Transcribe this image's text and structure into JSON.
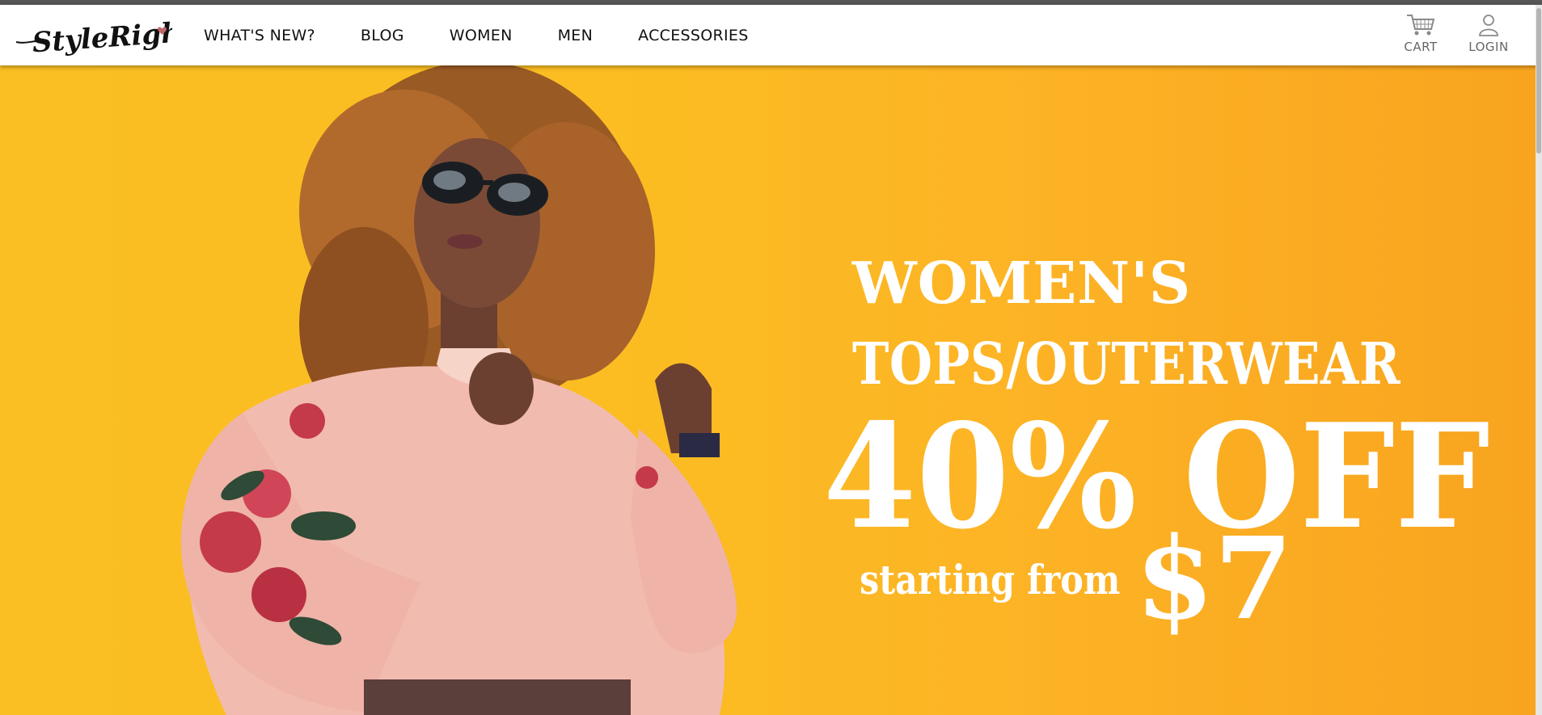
{
  "brand": {
    "name": "StyleRight",
    "accent_color": "#c0676b"
  },
  "nav": {
    "links": [
      {
        "label": "WHAT'S NEW?"
      },
      {
        "label": "BLOG"
      },
      {
        "label": "WOMEN"
      },
      {
        "label": "MEN"
      },
      {
        "label": "ACCESSORIES"
      }
    ],
    "cart": {
      "label": "CART",
      "icon": "cart-icon"
    },
    "login": {
      "label": "LOGIN",
      "icon": "user-icon"
    }
  },
  "hero": {
    "background_color": "#fbbd22",
    "image_description_icon": "model-photo",
    "headline_1": "WOMEN'S",
    "headline_2": "TOPS/OUTERWEAR",
    "discount": "40% OFF",
    "starting_text": "starting from",
    "price": "$7",
    "text_color": "#ffffff"
  }
}
